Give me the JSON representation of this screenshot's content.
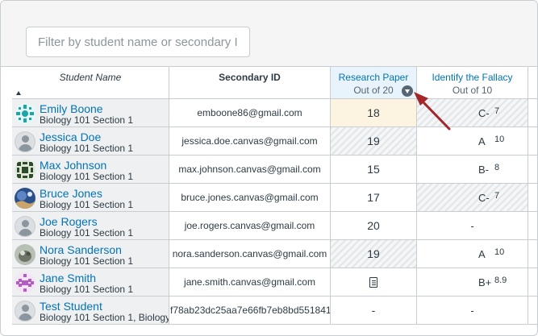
{
  "filter": {
    "placeholder": "Filter by student name or secondary ID"
  },
  "columns": {
    "student_name": "Student Name",
    "secondary_id": "Secondary ID",
    "research_paper": {
      "title": "Research Paper",
      "subtitle": "Out of 20"
    },
    "identify_fallacy": {
      "title": "Identify the Fallacy",
      "subtitle": "Out of 10"
    }
  },
  "rows": [
    {
      "name": "Emily Boone",
      "section": "Biology 101 Section 1",
      "secondary_id": "emboone86@gmail.com",
      "research_paper": "18",
      "fallacy_letter": "C-",
      "fallacy_score": "7",
      "avatar": "pattern-teal"
    },
    {
      "name": "Jessica Doe",
      "section": "Biology 101 Section 1",
      "secondary_id": "jessica.doe.canvas@gmail.com",
      "research_paper": "19",
      "fallacy_letter": "A",
      "fallacy_score": "10",
      "avatar": "default"
    },
    {
      "name": "Max Johnson",
      "section": "Biology 101 Section 1",
      "secondary_id": "max.johnson.canvas@gmail.com",
      "research_paper": "15",
      "fallacy_letter": "B-",
      "fallacy_score": "8",
      "avatar": "pattern-green"
    },
    {
      "name": "Bruce Jones",
      "section": "Biology 101 Section 1",
      "secondary_id": "bruce.jones.canvas@gmail.com",
      "research_paper": "17",
      "fallacy_letter": "C-",
      "fallacy_score": "7",
      "avatar": "photo-blue"
    },
    {
      "name": "Joe Rogers",
      "section": "Biology 101 Section 1",
      "secondary_id": "joe.rogers.canvas@gmail.com",
      "research_paper": "20",
      "fallacy_letter": "-",
      "fallacy_score": "",
      "avatar": "default"
    },
    {
      "name": "Nora Sanderson",
      "section": "Biology 101 Section 1",
      "secondary_id": "nora.sanderson.canvas@gmail.com",
      "research_paper": "19",
      "fallacy_letter": "A",
      "fallacy_score": "10",
      "avatar": "photo-gray"
    },
    {
      "name": "Jane Smith",
      "section": "Biology 101 Section 1",
      "secondary_id": "jane.smith.canvas@gmail.com",
      "research_paper": "",
      "fallacy_letter": "B+",
      "fallacy_score": "8.9",
      "avatar": "pattern-purple"
    },
    {
      "name": "Test Student",
      "section": "Biology 101 Section 1, Biology",
      "secondary_id": "f78ab23dc25aa7e66fb7eb8bd551841",
      "research_paper": "-",
      "fallacy_letter": "-",
      "fallacy_score": "",
      "avatar": "default"
    }
  ],
  "colors": {
    "link": "#0374b5",
    "active_cell": "#fdf3e1",
    "header_highlight": "#e9f3fb",
    "annotation_arrow": "#a3262a"
  }
}
